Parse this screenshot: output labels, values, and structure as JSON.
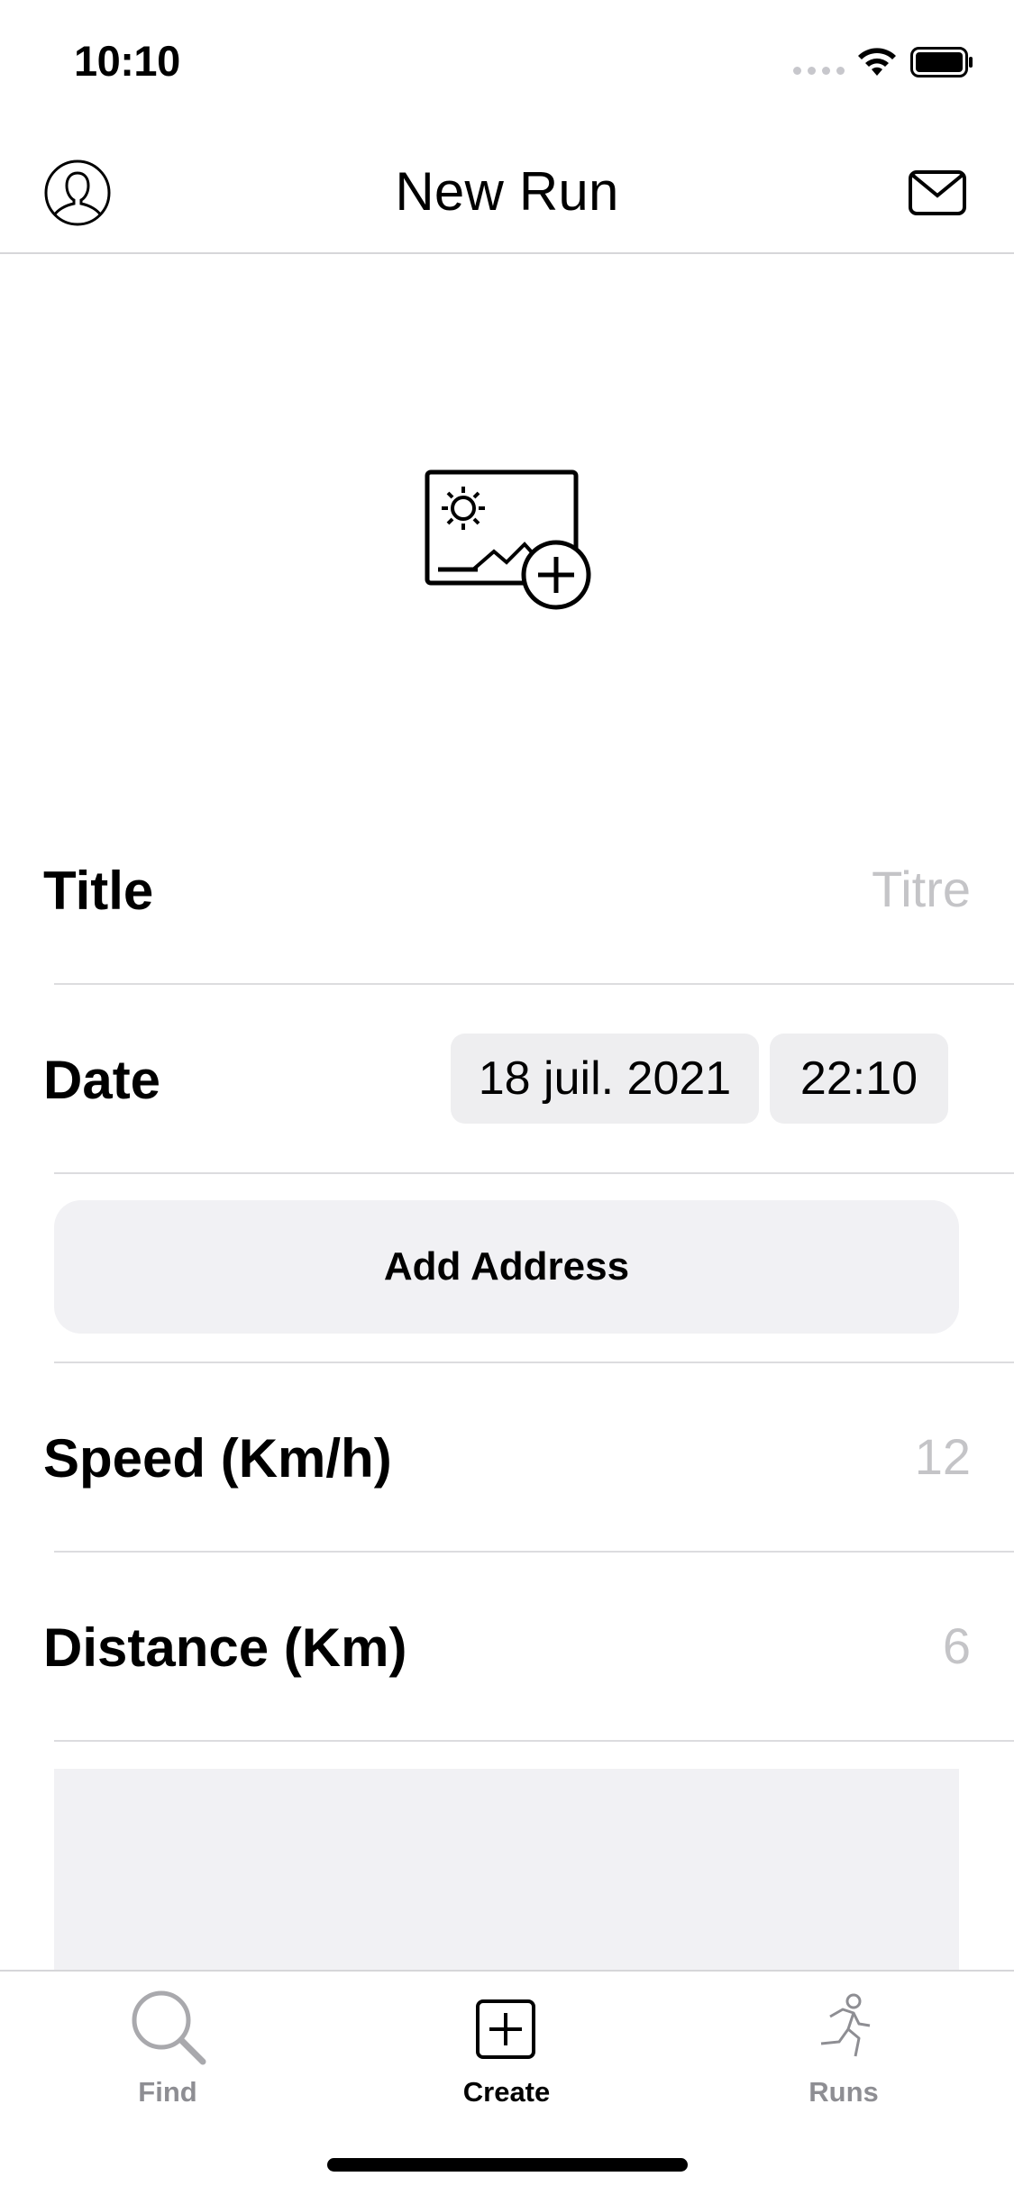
{
  "status_bar": {
    "time": "10:10"
  },
  "nav": {
    "title": "New Run",
    "left_icon": "person-circle-icon",
    "right_icon": "envelope-icon"
  },
  "image_picker": {
    "icon": "photo-add-icon"
  },
  "form": {
    "title": {
      "label": "Title",
      "placeholder": "Titre"
    },
    "date": {
      "label": "Date",
      "date_value": "18 juil. 2021",
      "time_value": "22:10"
    },
    "address_button": "Add Address",
    "speed": {
      "label": "Speed (Km/h)",
      "placeholder": "12"
    },
    "distance": {
      "label": "Distance (Km)",
      "placeholder": "6"
    }
  },
  "tabs": [
    {
      "label": "Find",
      "icon": "magnifying-glass-icon",
      "active": false
    },
    {
      "label": "Create",
      "icon": "plus-square-icon",
      "active": true
    },
    {
      "label": "Runs",
      "icon": "runner-icon",
      "active": false
    }
  ],
  "colors": {
    "placeholder": "#c4c4c7",
    "pill_bg": "#eeeef0",
    "button_bg": "#f1f1f4",
    "separator": "#dcdcdf",
    "inactive_tab": "#8e8e93"
  }
}
